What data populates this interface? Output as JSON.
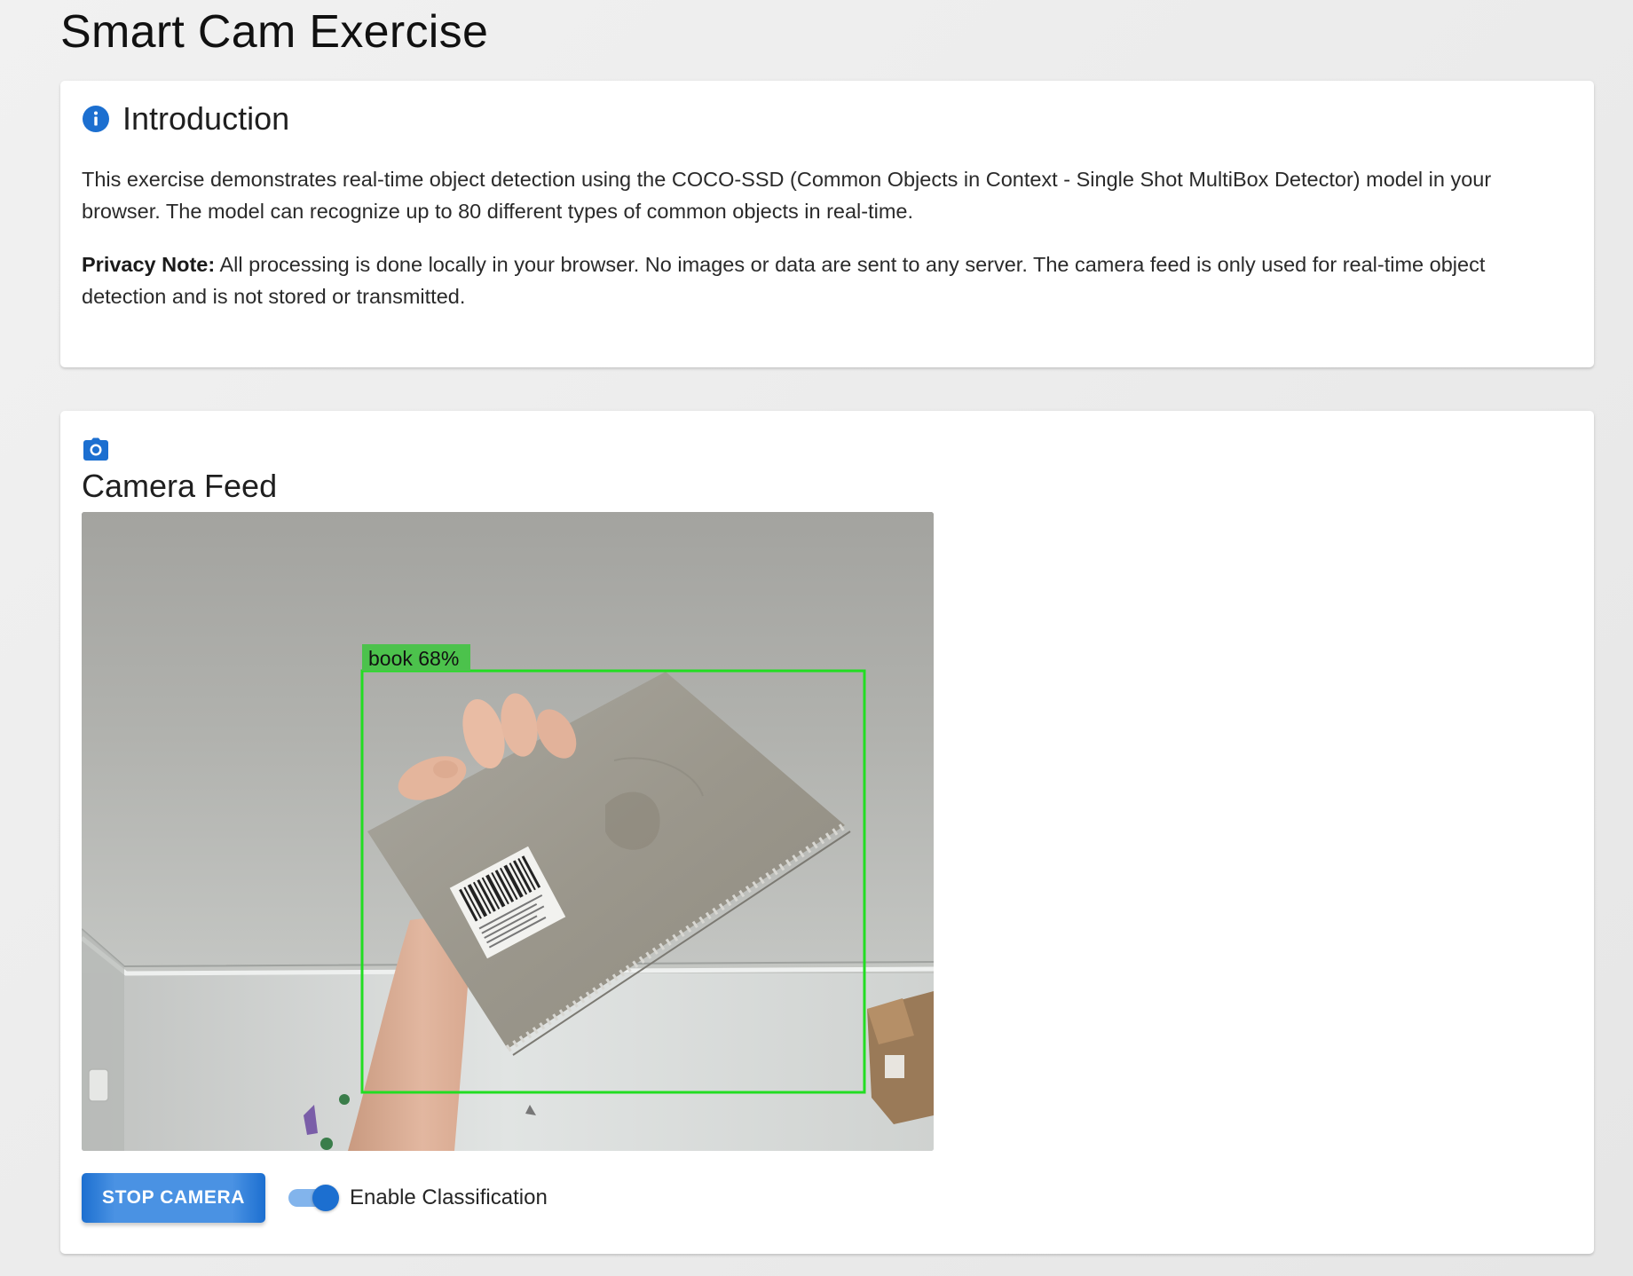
{
  "page": {
    "title": "Smart Cam Exercise"
  },
  "intro": {
    "icon": "info-icon",
    "title": "Introduction",
    "description": "This exercise demonstrates real-time object detection using the COCO-SSD (Common Objects in Context - Single Shot MultiBox Detector) model in your browser. The model can recognize up to 80 different types of common objects in real-time.",
    "privacy_label": "Privacy Note:",
    "privacy_text": "All processing is done locally in your browser. No images or data are sent to any server. The camera feed is only used for real-time object detection and is not stored or transmitted."
  },
  "camera": {
    "icon": "camera-icon",
    "title": "Camera Feed",
    "detection": {
      "class": "book",
      "confidence_percent": 68,
      "label": "book 68%"
    },
    "stop_button_label": "STOP CAMERA",
    "classification_toggle": {
      "label": "Enable Classification",
      "checked": true
    }
  },
  "colors": {
    "accent": "#1c6fd0",
    "detection_box": "#22dd22",
    "detection_label_bg": "#4cc24c"
  }
}
